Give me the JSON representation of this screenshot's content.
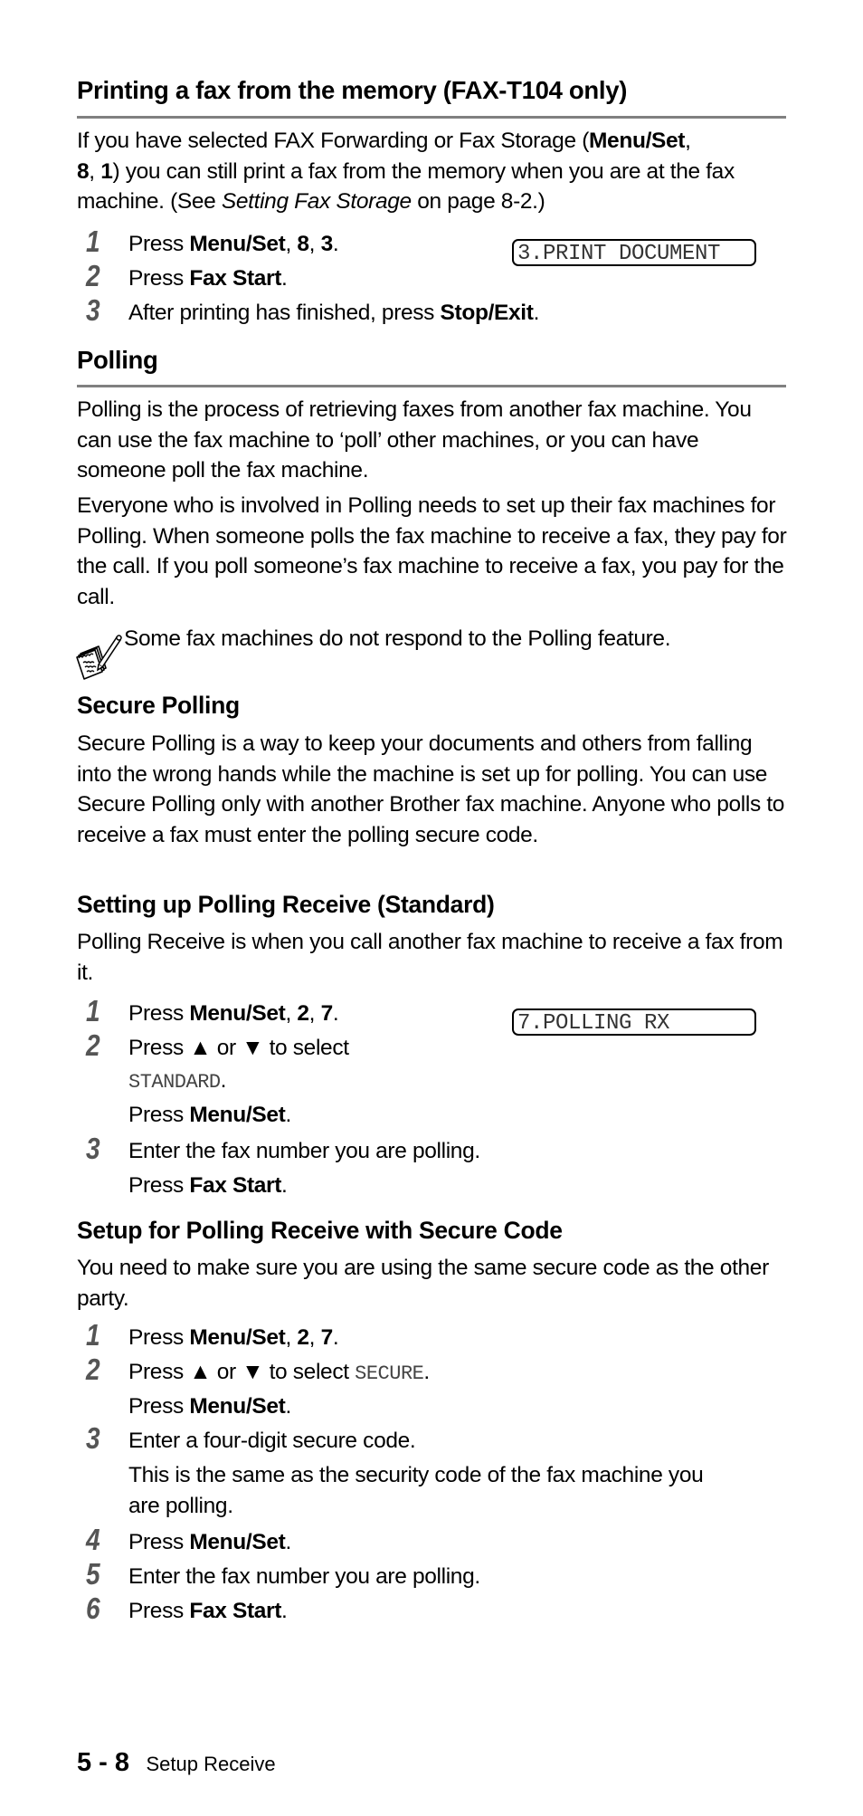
{
  "sections": {
    "print_from_memory": {
      "heading": "Printing a fax from the memory (FAX-T104 only)",
      "intro": {
        "t1": "If you have selected FAX Forwarding or Fax Storage (",
        "b1": "Menu/Set",
        "t2": ",",
        "b2": "8",
        "t3": ", ",
        "b3": "1",
        "t4": ") you can still print a fax from the memory when you are at the fax machine. (See ",
        "i1": "Setting Fax Storage",
        "t5": " on page 8-2.)"
      },
      "lcd": "3.PRINT DOCUMENT",
      "steps": [
        {
          "num": "1",
          "pre": "Press ",
          "bold1": "Menu/Set",
          "mid1": ", ",
          "bold2": "8",
          "mid2": ", ",
          "bold3": "3",
          "post": "."
        },
        {
          "num": "2",
          "pre": "Press ",
          "bold1": "Fax Start",
          "post": "."
        },
        {
          "num": "3",
          "pre": "After printing has finished, press ",
          "bold1": "Stop/Exit",
          "post": "."
        }
      ]
    },
    "polling": {
      "heading": "Polling",
      "para1": "Polling is the process of retrieving faxes from another fax machine. You can use the fax machine to ‘poll’ other machines, or you can have someone poll the fax machine.",
      "para2": "Everyone who is involved in Polling needs to set up their fax machines for Polling. When someone polls the fax machine to receive a fax, they pay for the call. If you poll someone’s fax machine to receive a fax, you pay for the call.",
      "note": {
        "icon": "note-pencil-icon",
        "text": "Some fax machines do not respond to the Polling feature."
      }
    },
    "secure_polling": {
      "heading": "Secure Polling",
      "para": "Secure Polling is a way to keep your documents and others from falling into the wrong hands while the machine is set up for polling. You can use Secure Polling only with another Brother fax machine. Anyone who polls to receive a fax must enter the polling secure code."
    },
    "polling_receive_standard": {
      "heading": "Setting up Polling Receive (Standard)",
      "para": "Polling Receive is when you call another fax machine to receive a fax from it.",
      "lcd": "7.POLLING RX",
      "steps": [
        {
          "num": "1",
          "pre": "Press ",
          "bold1": "Menu/Set",
          "mid1": ", ",
          "bold2": "2",
          "mid2": ", ",
          "bold3": "7",
          "post": "."
        },
        {
          "num": "2",
          "pre": "Press ▲ or ▼ to select",
          "mono": "STANDARD",
          "post": ".",
          "line2_pre": "Press ",
          "line2_bold": "Menu/Set",
          "line2_post": "."
        },
        {
          "num": "3",
          "pre": "Enter the fax number you are polling.",
          "line2_pre": "Press ",
          "line2_bold": "Fax Start",
          "line2_post": "."
        }
      ]
    },
    "polling_receive_secure": {
      "heading": "Setup for Polling Receive with Secure Code",
      "para": "You need to make sure you are using the same secure code as the other party.",
      "steps": [
        {
          "num": "1",
          "pre": "Press ",
          "bold1": "Menu/Set",
          "mid1": ", ",
          "bold2": "2",
          "mid2": ", ",
          "bold3": "7",
          "post": "."
        },
        {
          "num": "2",
          "pre": "Press ▲ or ▼ to select ",
          "mono": "SECURE",
          "post": ".",
          "line2_pre": "Press ",
          "line2_bold": "Menu/Set",
          "line2_post": "."
        },
        {
          "num": "3",
          "pre": "Enter a four-digit secure code.",
          "line2": "This is the same as the security code of the fax machine you",
          "line3": "are polling."
        },
        {
          "num": "4",
          "pre": "Press ",
          "bold1": "Menu/Set",
          "post": "."
        },
        {
          "num": "5",
          "pre": "Enter the fax number you are polling."
        },
        {
          "num": "6",
          "pre": "Press ",
          "bold1": "Fax Start",
          "post": "."
        }
      ]
    }
  },
  "footer": {
    "page_number": "5 - 8",
    "section_label": "Setup Receive"
  }
}
